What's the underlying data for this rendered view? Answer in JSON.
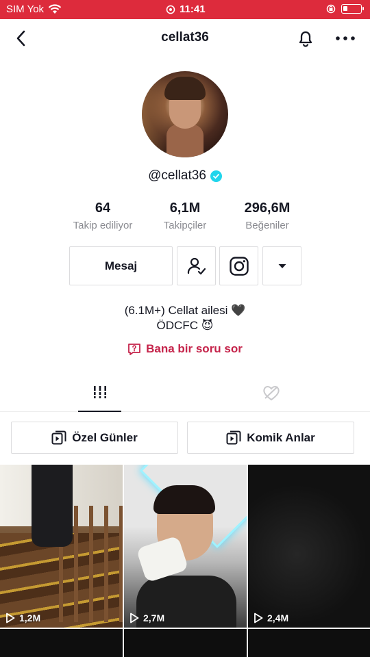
{
  "status_bar": {
    "carrier": "SIM Yok",
    "time": "11:41"
  },
  "nav": {
    "title": "cellat36"
  },
  "profile": {
    "handle": "@cellat36",
    "verified": true,
    "stats": [
      {
        "value": "64",
        "label": "Takip ediliyor"
      },
      {
        "value": "6,1M",
        "label": "Takipçiler"
      },
      {
        "value": "296,6M",
        "label": "Beğeniler"
      }
    ],
    "message_button": "Mesaj",
    "bio_line1": "(6.1M+) Cellat ailesi 🖤",
    "bio_line2": "ÖDCFC 😈",
    "ask_button": "Bana bir soru sor"
  },
  "playlists": [
    {
      "label": "Özel Günler"
    },
    {
      "label": "Komik Anlar"
    }
  ],
  "videos": [
    {
      "views": "1,2M"
    },
    {
      "views": "2,7M"
    },
    {
      "views": "2,4M"
    }
  ],
  "colors": {
    "status_bar": "#dd2b3c",
    "accent_red": "#c5234a",
    "verified_badge": "#20d5ec",
    "text": "#161823",
    "secondary_text": "#8a8b91"
  },
  "icons": [
    "wifi-icon",
    "alarm-icon",
    "lock-rotation-icon",
    "battery-icon",
    "back-arrow-icon",
    "bell-icon",
    "more-dots-icon",
    "verified-icon",
    "add-friend-icon",
    "instagram-icon",
    "dropdown-arrow-icon",
    "question-icon",
    "videos-grid-icon",
    "liked-heart-icon",
    "playlist-icon",
    "play-icon"
  ]
}
